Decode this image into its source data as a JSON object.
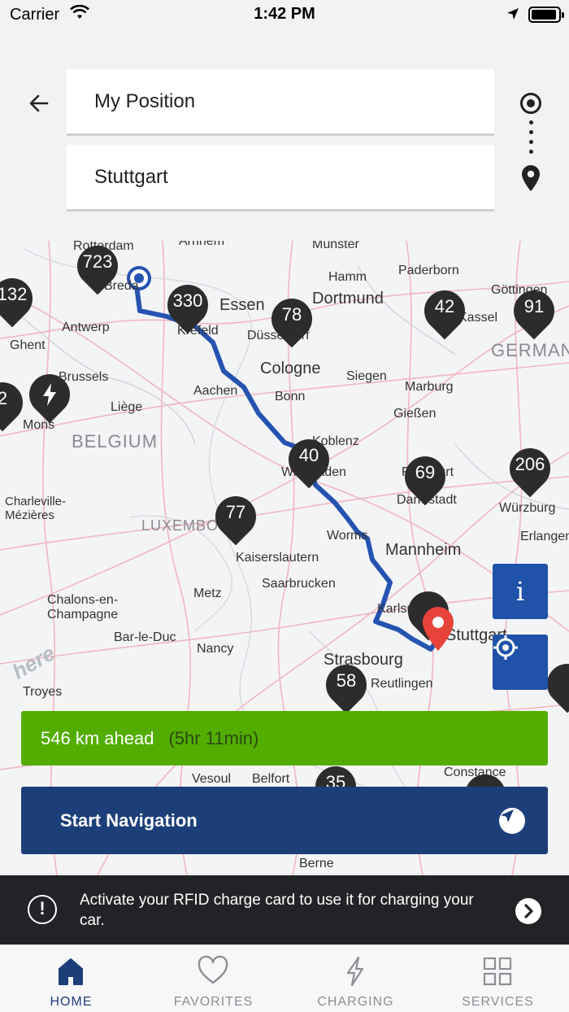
{
  "status_bar": {
    "carrier": "Carrier",
    "time": "1:42 PM"
  },
  "search": {
    "origin_value": "My Position",
    "destination_value": "Stuttgart"
  },
  "map": {
    "cities": [
      {
        "name": "Rotterdam"
      },
      {
        "name": "Arnhem"
      },
      {
        "name": "Münster"
      },
      {
        "name": "Paderborn"
      },
      {
        "name": "Hamm"
      },
      {
        "name": "Dortmund"
      },
      {
        "name": "Göttingen"
      },
      {
        "name": "Essen"
      },
      {
        "name": "Breda"
      },
      {
        "name": "Antwerp"
      },
      {
        "name": "Krefeld"
      },
      {
        "name": "Düsseldorf"
      },
      {
        "name": "Kassel"
      },
      {
        "name": "Ghent"
      },
      {
        "name": "Cologne"
      },
      {
        "name": "Siegen"
      },
      {
        "name": "Brussels"
      },
      {
        "name": "Aachen"
      },
      {
        "name": "Marburg"
      },
      {
        "name": "Bonn"
      },
      {
        "name": "Liège"
      },
      {
        "name": "Gießen"
      },
      {
        "name": "Mons"
      },
      {
        "name": "Koblenz"
      },
      {
        "name": "Wiesbaden"
      },
      {
        "name": "Frankfurt"
      },
      {
        "name": "Charleville-Mézières"
      },
      {
        "name": "Darmstadt"
      },
      {
        "name": "Würzburg"
      },
      {
        "name": "Erlangen"
      },
      {
        "name": "Worms"
      },
      {
        "name": "Mannheim"
      },
      {
        "name": "Kaiserslautern"
      },
      {
        "name": "Saarbrucken"
      },
      {
        "name": "Chalons-en-Champagne"
      },
      {
        "name": "Metz"
      },
      {
        "name": "Karlsruhe"
      },
      {
        "name": "Bar-le-Duc"
      },
      {
        "name": "Stuttgart"
      },
      {
        "name": "Nancy"
      },
      {
        "name": "Strasbourg"
      },
      {
        "name": "Troyes"
      },
      {
        "name": "Reutlingen"
      },
      {
        "name": "Constance"
      },
      {
        "name": "Vesoul"
      },
      {
        "name": "Belfort"
      },
      {
        "name": "Berne"
      }
    ],
    "countries": [
      "BELGIUM",
      "LUXEMBOURG",
      "GERMANY"
    ],
    "clusters": [
      "723",
      "132",
      "330",
      "78",
      "42",
      "91",
      "2",
      "40",
      "69",
      "206",
      "77",
      "58",
      "35"
    ],
    "here_logo": "here"
  },
  "eta": {
    "distance": "546 km ahead",
    "duration": "(5hr 11min)"
  },
  "navigation": {
    "start_label": "Start Navigation"
  },
  "notice": {
    "text": "Activate your RFID charge card to use it for charging your car."
  },
  "tabs": [
    {
      "label": "HOME",
      "icon": "home-icon",
      "active": true
    },
    {
      "label": "FAVORITES",
      "icon": "heart-icon",
      "active": false
    },
    {
      "label": "CHARGING",
      "icon": "lightning-icon",
      "active": false
    },
    {
      "label": "SERVICES",
      "icon": "grid-icon",
      "active": false
    }
  ],
  "colors": {
    "accent": "#1c3f7a",
    "route": "#2553b0",
    "eta": "#52ad00",
    "destination_pin": "#e8433a"
  }
}
